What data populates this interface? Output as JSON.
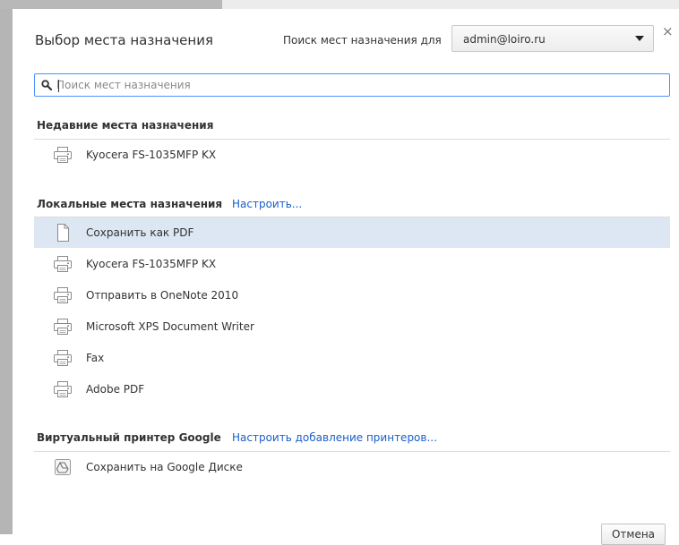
{
  "dialog": {
    "title": "Выбор места назначения",
    "search_for_label": "Поиск мест назначения для",
    "account": "admin@loiro.ru",
    "close_symbol": "×"
  },
  "search": {
    "placeholder": "Поиск мест назначения",
    "value": ""
  },
  "recent": {
    "header": "Недавние места назначения",
    "items": [
      {
        "label": "Kyocera FS-1035MFP KX",
        "icon": "printer-icon"
      }
    ]
  },
  "local": {
    "header": "Локальные места назначения",
    "link": "Настроить...",
    "items": [
      {
        "label": "Сохранить как PDF",
        "icon": "pdf-file-icon",
        "selected": true
      },
      {
        "label": "Kyocera FS-1035MFP KX",
        "icon": "printer-icon"
      },
      {
        "label": "Отправить в OneNote 2010",
        "icon": "printer-icon"
      },
      {
        "label": "Microsoft XPS Document Writer",
        "icon": "printer-icon"
      },
      {
        "label": "Fax",
        "icon": "printer-icon"
      },
      {
        "label": "Adobe PDF",
        "icon": "printer-icon"
      }
    ]
  },
  "cloud": {
    "header": "Виртуальный принтер Google",
    "link": "Настроить добавление принтеров...",
    "items": [
      {
        "label": "Сохранить на Google Диске",
        "icon": "google-drive-icon"
      }
    ]
  },
  "footer": {
    "cancel_label": "Отмена"
  },
  "colors": {
    "accent_link": "#1a5fc9",
    "selected_row": "#dde6f3",
    "search_border": "#4d90fe"
  }
}
